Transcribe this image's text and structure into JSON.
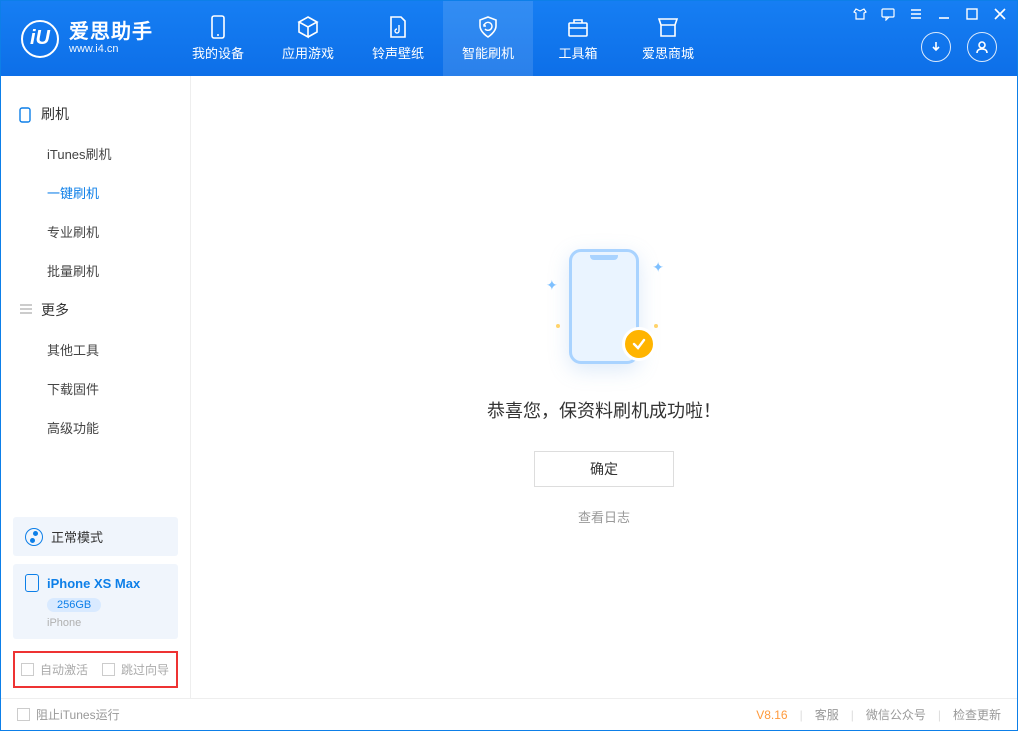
{
  "app": {
    "title": "爱思助手",
    "subtitle": "www.i4.cn",
    "logo_glyph": "iU"
  },
  "top_tabs": [
    {
      "label": "我的设备"
    },
    {
      "label": "应用游戏"
    },
    {
      "label": "铃声壁纸"
    },
    {
      "label": "智能刷机"
    },
    {
      "label": "工具箱"
    },
    {
      "label": "爱思商城"
    }
  ],
  "sidebar": {
    "group1_title": "刷机",
    "group1_items": [
      {
        "label": "iTunes刷机"
      },
      {
        "label": "一键刷机"
      },
      {
        "label": "专业刷机"
      },
      {
        "label": "批量刷机"
      }
    ],
    "group2_title": "更多",
    "group2_items": [
      {
        "label": "其他工具"
      },
      {
        "label": "下载固件"
      },
      {
        "label": "高级功能"
      }
    ]
  },
  "status_mode": "正常模式",
  "device": {
    "name": "iPhone XS Max",
    "storage": "256GB",
    "type": "iPhone"
  },
  "checks": {
    "auto_activate": "自动激活",
    "skip_guide": "跳过向导"
  },
  "main": {
    "success_text": "恭喜您，保资料刷机成功啦！",
    "ok_button": "确定",
    "view_log": "查看日志"
  },
  "footer": {
    "block_itunes": "阻止iTunes运行",
    "version": "V8.16",
    "links": [
      "客服",
      "微信公众号",
      "检查更新"
    ]
  }
}
